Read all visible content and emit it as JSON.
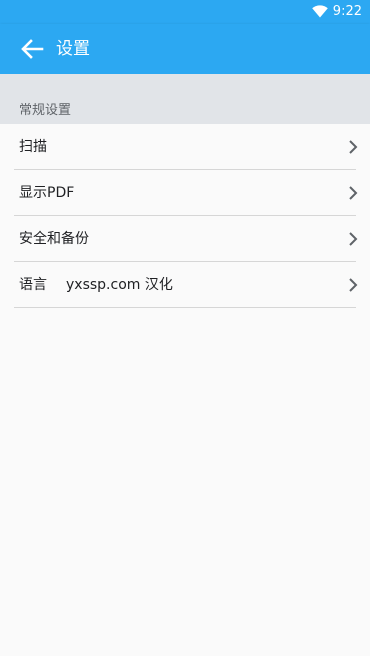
{
  "status_bar": {
    "time": "9:22",
    "icons": [
      "wifi-icon"
    ]
  },
  "app_bar": {
    "title": "设置",
    "back_icon": "back-arrow-icon"
  },
  "section": {
    "title": "常规设置"
  },
  "settings": [
    {
      "label": "扫描",
      "value": "",
      "icon": "chevron-right-icon"
    },
    {
      "label": "显示PDF",
      "value": "",
      "icon": "chevron-right-icon"
    },
    {
      "label": "安全和备份",
      "value": "",
      "icon": "chevron-right-icon"
    },
    {
      "label": "语言",
      "value": "yxssp.com 汉化",
      "icon": "chevron-right-icon"
    }
  ],
  "colors": {
    "primary": "#2ca8f2",
    "section_band": "#e1e4e8",
    "background": "#fafafa",
    "divider": "#d6d6d6"
  }
}
